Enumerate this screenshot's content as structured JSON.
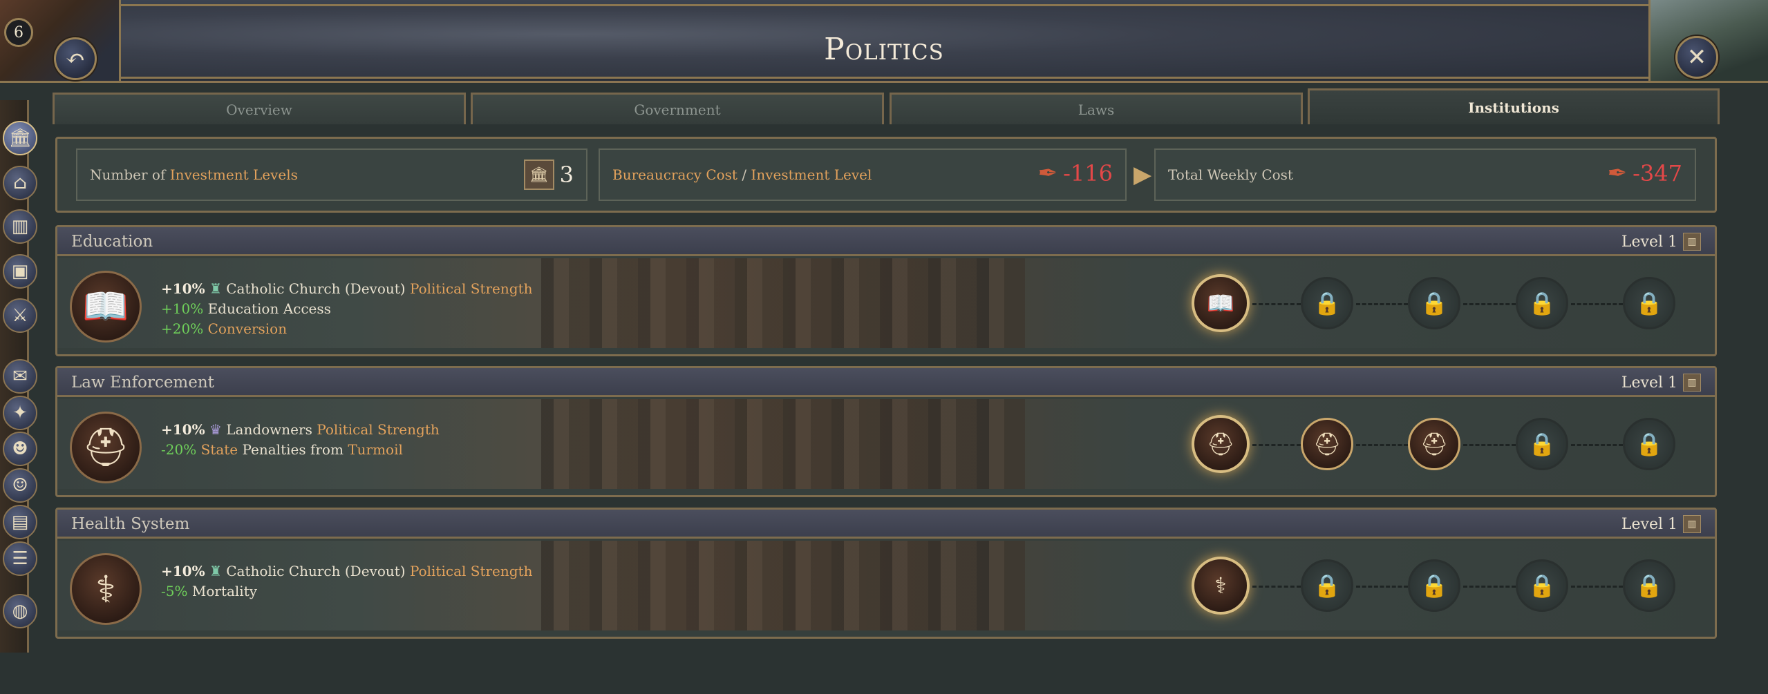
{
  "header": {
    "title": "Politics",
    "badge": "6",
    "back_icon": "undo-arrow-icon",
    "close_icon": "close-icon"
  },
  "tabs": [
    {
      "label": "Overview",
      "active": false
    },
    {
      "label": "Government",
      "active": false
    },
    {
      "label": "Laws",
      "active": false
    },
    {
      "label": "Institutions",
      "active": true
    }
  ],
  "costs": {
    "investment_levels": {
      "prefix": "Number of ",
      "highlight": "Investment Levels",
      "value": "3"
    },
    "bureaucracy": {
      "part1": "Bureaucracy Cost",
      "sep": " / ",
      "part2": "Investment Level",
      "value": "-116"
    },
    "total": {
      "label": "Total Weekly Cost",
      "value": "-347"
    }
  },
  "sidebar_icons": [
    "institution-icon",
    "building-icon",
    "factory-icon",
    "goods-icon",
    "military-icon",
    "diplomacy-icon",
    "tech-icon",
    "culture-icon",
    "pop-icon",
    "book-icon",
    "document-icon",
    "globe-icon"
  ],
  "institutions": [
    {
      "name": "Education",
      "level": "Level 1",
      "icon": "book-icon",
      "mods": [
        {
          "value": "+10%",
          "icon": "church-icon",
          "group": "Catholic Church (Devout)",
          "text": "Political Strength"
        },
        {
          "value": "+10%",
          "text": "Education Access"
        },
        {
          "value": "+20%",
          "text": "Conversion"
        }
      ],
      "slots": [
        "active",
        "locked",
        "locked",
        "locked",
        "locked"
      ]
    },
    {
      "name": "Law Enforcement",
      "level": "Level 1",
      "icon": "police-cap-icon",
      "mods": [
        {
          "value": "+10%",
          "icon": "landowner-icon",
          "group": "Landowners",
          "text": "Political Strength"
        },
        {
          "value": "-20%",
          "text1": "State",
          "text2": "Penalties from",
          "text3": "Turmoil"
        }
      ],
      "slots": [
        "active",
        "unlocked",
        "unlocked",
        "locked",
        "locked"
      ]
    },
    {
      "name": "Health System",
      "level": "Level 1",
      "icon": "caduceus-icon",
      "mods": [
        {
          "value": "+10%",
          "icon": "church-icon",
          "group": "Catholic Church (Devout)",
          "text": "Political Strength"
        },
        {
          "value": "-5%",
          "text": "Mortality"
        }
      ],
      "slots": [
        "active",
        "locked",
        "locked",
        "locked",
        "locked"
      ]
    }
  ]
}
